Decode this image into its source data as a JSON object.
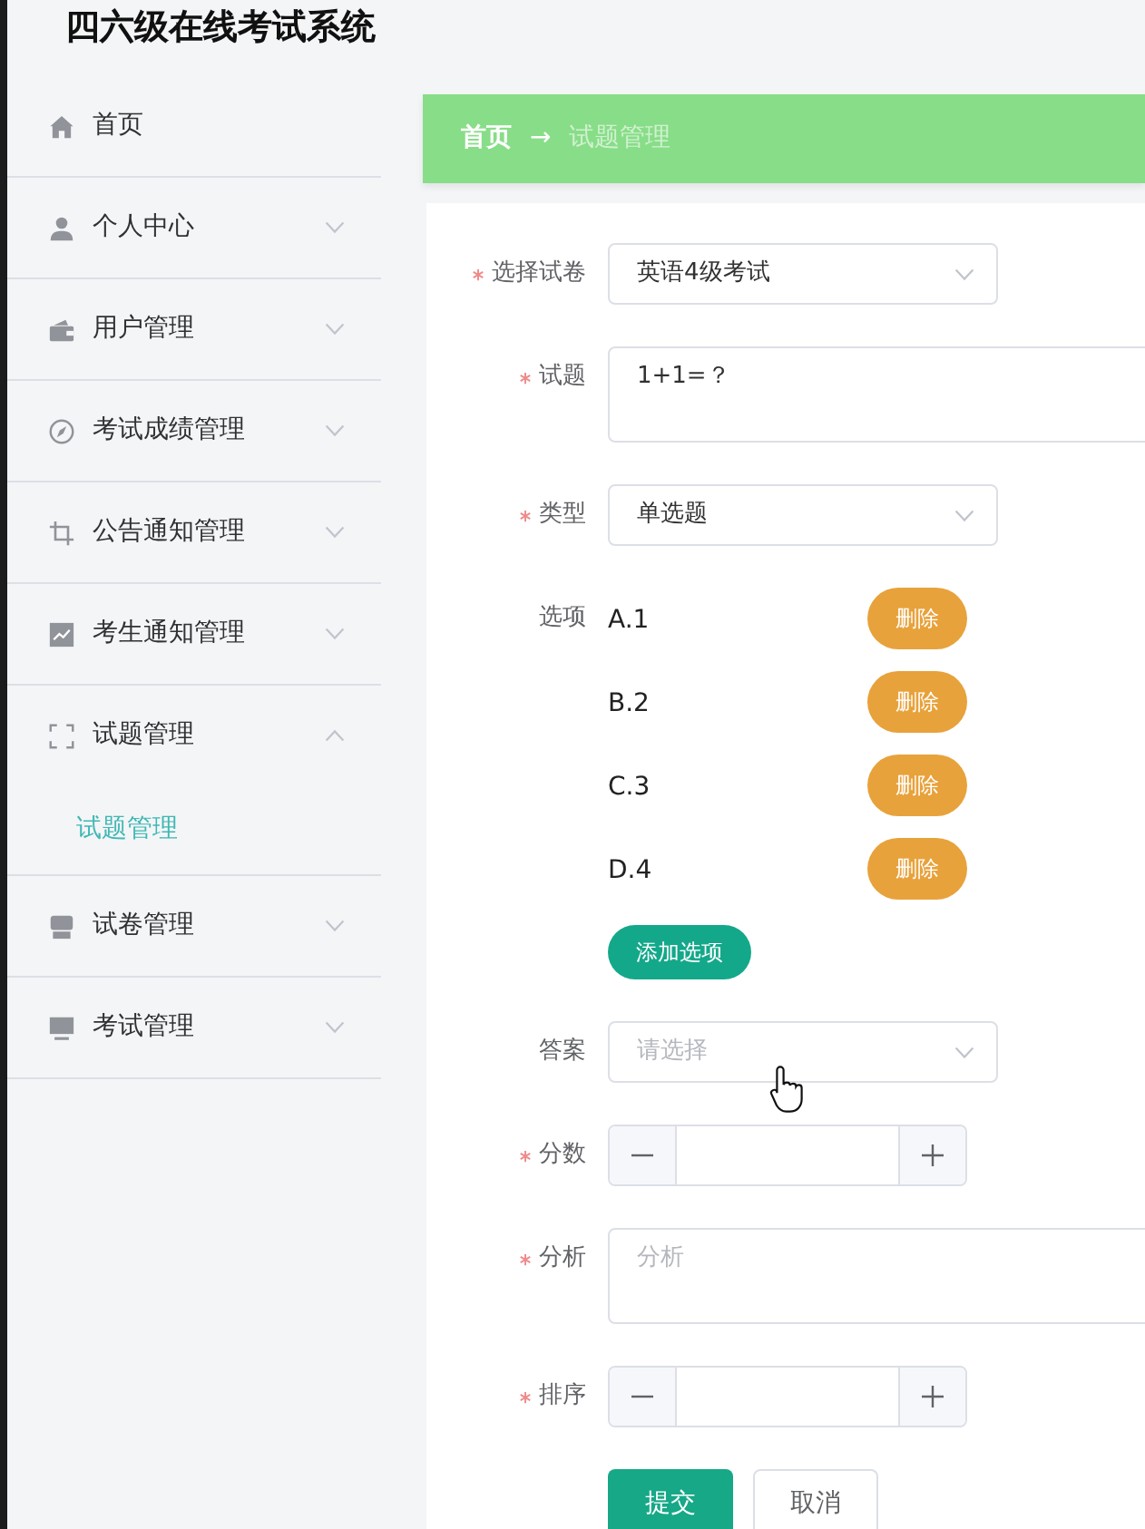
{
  "app": {
    "title": "四六级在线考试系统"
  },
  "sidebar": {
    "items": [
      {
        "label": "首页",
        "kind": "link"
      },
      {
        "label": "个人中心",
        "kind": "submenu",
        "expanded": false
      },
      {
        "label": "用户管理",
        "kind": "submenu",
        "expanded": false
      },
      {
        "label": "考试成绩管理",
        "kind": "submenu",
        "expanded": false
      },
      {
        "label": "公告通知管理",
        "kind": "submenu",
        "expanded": false
      },
      {
        "label": "考生通知管理",
        "kind": "submenu",
        "expanded": false
      },
      {
        "label": "试题管理",
        "kind": "submenu",
        "expanded": true,
        "children": [
          {
            "label": "试题管理",
            "selected": true
          }
        ]
      },
      {
        "label": "试卷管理",
        "kind": "submenu",
        "expanded": false
      },
      {
        "label": "考试管理",
        "kind": "submenu",
        "expanded": false
      }
    ]
  },
  "breadcrumb": {
    "separator": "→",
    "items": [
      {
        "label": "首页",
        "current": false
      },
      {
        "label": "试题管理",
        "current": true
      }
    ]
  },
  "form": {
    "fields": [
      {
        "kind": "select",
        "label": "选择试卷",
        "required": true,
        "value": "英语4级考试"
      },
      {
        "kind": "textarea",
        "label": "试题",
        "required": true,
        "value": "1+1=？"
      },
      {
        "kind": "select",
        "label": "类型",
        "required": true,
        "value": "单选题"
      },
      {
        "kind": "options",
        "label": "选项",
        "required": false,
        "options": [
          {
            "text": "A.1",
            "button": "删除"
          },
          {
            "text": "B.2",
            "button": "删除"
          },
          {
            "text": "C.3",
            "button": "删除"
          },
          {
            "text": "D.4",
            "button": "删除"
          }
        ],
        "add_button": "添加选项"
      },
      {
        "kind": "select",
        "label": "答案",
        "required": false,
        "placeholder": "请选择"
      },
      {
        "kind": "number",
        "label": "分数",
        "required": true
      },
      {
        "kind": "textarea",
        "label": "分析",
        "required": true,
        "placeholder": "分析"
      },
      {
        "kind": "number",
        "label": "排序",
        "required": true
      }
    ],
    "buttons": [
      {
        "label": "提交",
        "kind": "primary"
      },
      {
        "label": "取消",
        "kind": "default"
      }
    ]
  }
}
